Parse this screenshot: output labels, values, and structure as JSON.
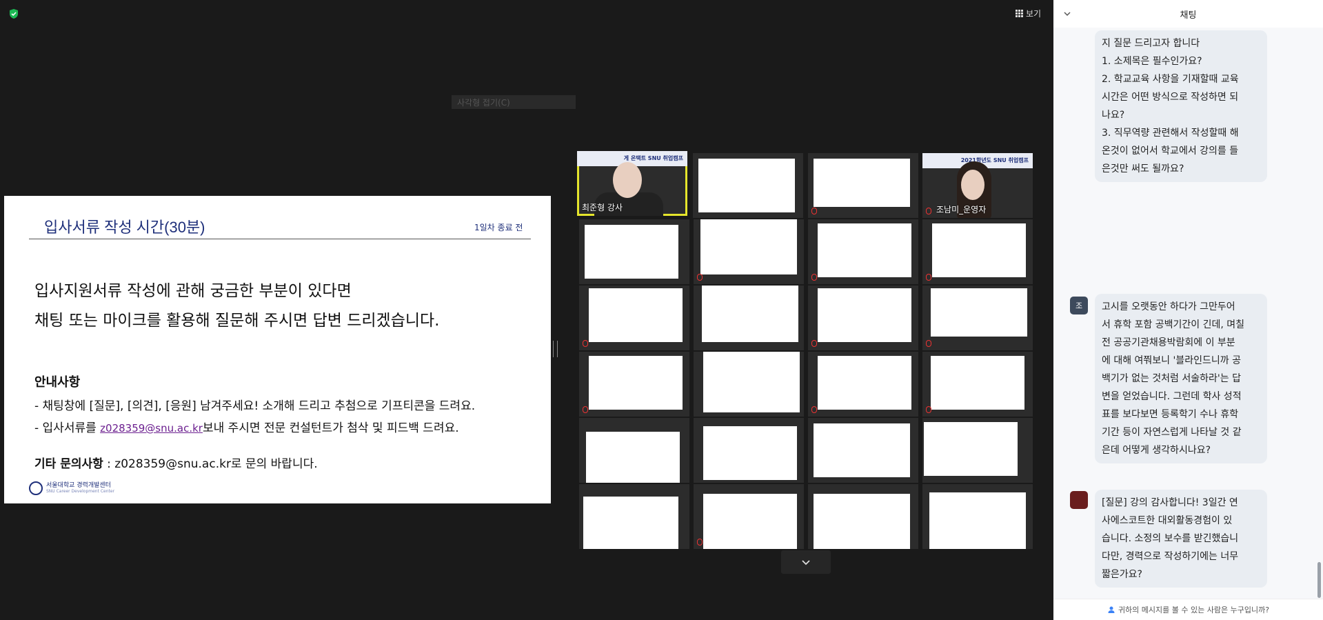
{
  "toolbar": {
    "view_label": "보기",
    "mini_bar_label": "사각형 접기(C)"
  },
  "slide": {
    "title": "입사서류 작성 시간(30분)",
    "subtag": "1일차 종료 전",
    "question_line1": "입사지원서류 작성에 관해 궁금한 부분이 있다면",
    "question_line2": "채팅 또는 마이크를 활용해 질문해 주시면 답변 드리겠습니다.",
    "notice_title": "안내사항",
    "notice_1": "- 채팅창에 [질문], [의견], [응원] 남겨주세요! 소개해 드리고 추첨으로 기프티콘을 드려요.",
    "notice_2_prefix": "- 입사서류를 ",
    "notice_2_email": "z028359@snu.ac.kr",
    "notice_2_suffix": "보내 주시면 전문 컨설턴트가 첨삭 및 피드백 드려요.",
    "etc_label": "기타 문의사항",
    "etc_text": " : z028359@snu.ac.kr로 문의 바랍니다.",
    "logo_text": "서울대학교 경력개발센터",
    "logo_subtext": "SNU Career Development Center"
  },
  "video": {
    "presenter_name": "최준형 강사",
    "presenter_banner": "게 온택트 SNU 취업캠프",
    "host_name": "조남미_운영자",
    "host_banner": "2021학년도 SNU 취업캠프"
  },
  "chat": {
    "title": "채팅",
    "messages": [
      {
        "lines": [
          "지 질문 드리고자 합니다",
          "1. 소제목은 필수인가요?",
          "2. 학교교육 사항을 기재할때 교육",
          "시간은 어떤 방식으로 작성하면 되",
          "나요?",
          "3. 직무역량 관련해서 작성할때 해",
          "온것이 없어서 학교에서 강의를 들",
          "은것만 써도 될까요?"
        ]
      },
      {
        "avatar": "조",
        "lines": [
          "고시를 오랫동안 하다가 그만두어",
          "서 휴학 포함 공백기간이 긴데, 며칠",
          "전 공공기관채용박람회에 이 부분",
          "에 대해 여쭤보니 '블라인드니까 공",
          "백기가 없는 것처럼 서술하라'는 답",
          "변을 얻었습니다. 그런데 학사 성적",
          "표를 보다보면 등록학기 수나 휴학",
          "기간 등이 자연스럽게 나타날 것 같",
          "은데 어떻게 생각하시나요?"
        ]
      },
      {
        "lines": [
          "[질문] 강의 감사합니다! 3일간 연",
          "사에스코트한 대외활동경험이 있",
          "습니다. 소정의 보수를 받긴했습니",
          "다만, 경력으로 작성하기에는 너무",
          "짧은가요?"
        ]
      }
    ],
    "footer_text": "귀하의 메시지를 볼 수 있는 사람은 누구입니까?"
  },
  "colors": {
    "accent_yellow": "#e6e62c",
    "shield_green": "#1db954",
    "slide_navy": "#1e2f7a"
  }
}
